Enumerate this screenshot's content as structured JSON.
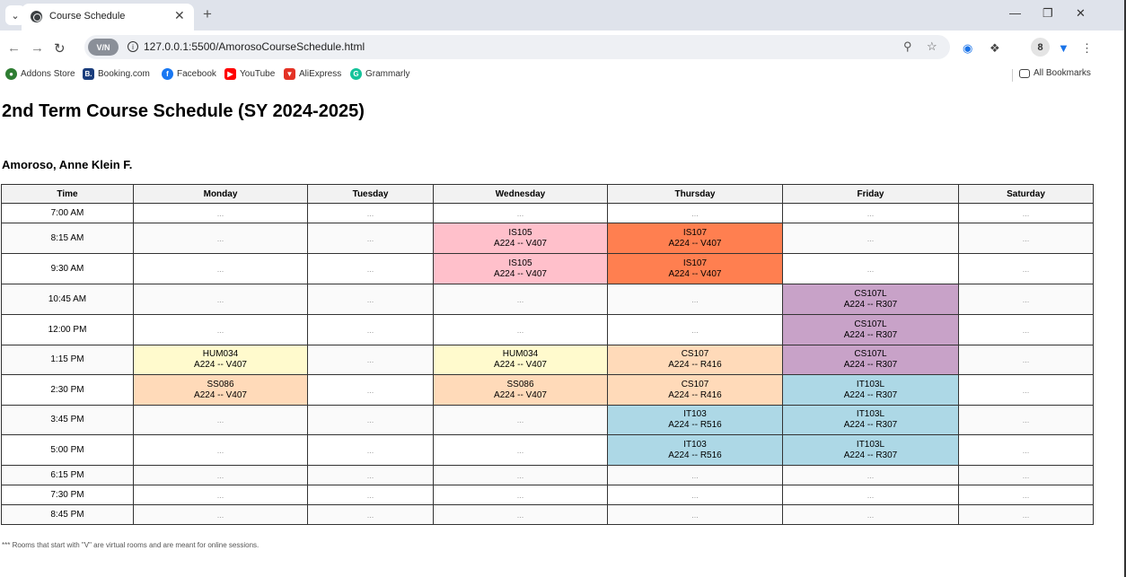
{
  "browser": {
    "tab_title": "Course Schedule",
    "url": "127.0.0.1:5500/AmorosoCourseSchedule.html",
    "vpn_label": "V/N",
    "bookmarks": [
      "Addons Store",
      "Booking.com",
      "Facebook",
      "YouTube",
      "AliExpress",
      "Grammarly"
    ],
    "all_bookmarks": "All Bookmarks",
    "profile_letter": "8"
  },
  "page": {
    "title": "2nd Term Course Schedule (SY 2024-2025)",
    "student": "Amoroso, Anne Klein F.",
    "footnote": "*** Rooms that start with \"V\" are virtual rooms and are meant for online sessions."
  },
  "schedule": {
    "headers": [
      "Time",
      "Monday",
      "Tuesday",
      "Wednesday",
      "Thursday",
      "Friday",
      "Saturday"
    ],
    "rows": [
      {
        "time": "7:00 AM",
        "h": "short",
        "cells": [
          {
            "e": "..."
          },
          {
            "e": "..."
          },
          {
            "e": "..."
          },
          {
            "e": "..."
          },
          {
            "e": "..."
          },
          {
            "e": "..."
          }
        ]
      },
      {
        "time": "8:15 AM",
        "h": "tall",
        "cells": [
          {
            "e": "..."
          },
          {
            "e": "..."
          },
          {
            "code": "IS105",
            "room": "A224 -- V407",
            "color": "pink"
          },
          {
            "code": "IS107",
            "room": "A224 -- V407",
            "color": "orange"
          },
          {
            "e": "..."
          },
          {
            "e": "..."
          }
        ]
      },
      {
        "time": "9:30 AM",
        "h": "tall",
        "cells": [
          {
            "e": "..."
          },
          {
            "e": "..."
          },
          {
            "code": "IS105",
            "room": "A224 -- V407",
            "color": "pink"
          },
          {
            "code": "IS107",
            "room": "A224 -- V407",
            "color": "orange"
          },
          {
            "e": "..."
          },
          {
            "e": "..."
          }
        ]
      },
      {
        "time": "10:45 AM",
        "h": "tall",
        "cells": [
          {
            "e": "..."
          },
          {
            "e": "..."
          },
          {
            "e": "..."
          },
          {
            "e": "..."
          },
          {
            "code": "CS107L",
            "room": "A224 -- R307",
            "color": "purple"
          },
          {
            "e": "..."
          }
        ]
      },
      {
        "time": "12:00 PM",
        "h": "tall",
        "cells": [
          {
            "e": "..."
          },
          {
            "e": "..."
          },
          {
            "e": "..."
          },
          {
            "e": "..."
          },
          {
            "code": "CS107L",
            "room": "A224 -- R307",
            "color": "purple"
          },
          {
            "e": "..."
          }
        ]
      },
      {
        "time": "1:15 PM",
        "h": "med",
        "cells": [
          {
            "code": "HUM034",
            "room": "A224 -- V407",
            "color": "yellow"
          },
          {
            "e": "..."
          },
          {
            "code": "HUM034",
            "room": "A224 -- V407",
            "color": "yellow"
          },
          {
            "code": "CS107",
            "room": "A224 -- R416",
            "color": "peach"
          },
          {
            "code": "CS107L",
            "room": "A224 -- R307",
            "color": "purple"
          },
          {
            "e": "..."
          }
        ]
      },
      {
        "time": "2:30 PM",
        "h": "tall",
        "cells": [
          {
            "code": "SS086",
            "room": "A224 -- V407",
            "color": "peach"
          },
          {
            "e": "..."
          },
          {
            "code": "SS086",
            "room": "A224 -- V407",
            "color": "peach"
          },
          {
            "code": "CS107",
            "room": "A224 -- R416",
            "color": "peach"
          },
          {
            "code": "IT103L",
            "room": "A224 -- R307",
            "color": "blue"
          },
          {
            "e": "..."
          }
        ]
      },
      {
        "time": "3:45 PM",
        "h": "med",
        "cells": [
          {
            "e": "..."
          },
          {
            "e": "..."
          },
          {
            "e": "..."
          },
          {
            "code": "IT103",
            "room": "A224 -- R516",
            "color": "blue"
          },
          {
            "code": "IT103L",
            "room": "A224 -- R307",
            "color": "blue"
          },
          {
            "e": "..."
          }
        ]
      },
      {
        "time": "5:00 PM",
        "h": "tall",
        "cells": [
          {
            "e": "..."
          },
          {
            "e": "..."
          },
          {
            "e": "..."
          },
          {
            "code": "IT103",
            "room": "A224 -- R516",
            "color": "blue"
          },
          {
            "code": "IT103L",
            "room": "A224 -- R307",
            "color": "blue"
          },
          {
            "e": "..."
          }
        ]
      },
      {
        "time": "6:15 PM",
        "h": "short",
        "cells": [
          {
            "e": "..."
          },
          {
            "e": "..."
          },
          {
            "e": "..."
          },
          {
            "e": "..."
          },
          {
            "e": "..."
          },
          {
            "e": "..."
          }
        ]
      },
      {
        "time": "7:30 PM",
        "h": "short",
        "cells": [
          {
            "e": "..."
          },
          {
            "e": "..."
          },
          {
            "e": "..."
          },
          {
            "e": "..."
          },
          {
            "e": "..."
          },
          {
            "e": "..."
          }
        ]
      },
      {
        "time": "8:45 PM",
        "h": "short",
        "cells": [
          {
            "e": "..."
          },
          {
            "e": "..."
          },
          {
            "e": "..."
          },
          {
            "e": "..."
          },
          {
            "e": "..."
          },
          {
            "e": "..."
          }
        ]
      }
    ]
  },
  "colors": {
    "pink": "#ffc0cb",
    "orange": "#ff7f50",
    "purple": "#c8a2c8",
    "yellow": "#fffacd",
    "peach": "#ffdab9",
    "blue": "#add8e6"
  }
}
